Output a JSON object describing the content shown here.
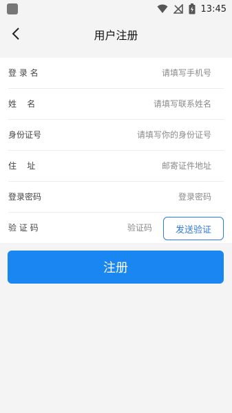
{
  "status": {
    "time": "13:45"
  },
  "header": {
    "title": "用户注册"
  },
  "form": {
    "fields": [
      {
        "label": "登 录 名",
        "placeholder": "请填写手机号"
      },
      {
        "label": "姓    名",
        "placeholder": "请填写联系姓名"
      },
      {
        "label": "身份证号",
        "placeholder": "请填写你的身份证号"
      },
      {
        "label": "住    址",
        "placeholder": "邮寄证件地址"
      },
      {
        "label": "登录密码",
        "placeholder": "登录密码"
      },
      {
        "label": "验 证 码",
        "placeholder": "验证码"
      }
    ],
    "send_code_label": "发送验证"
  },
  "register_label": "注册",
  "icons": {
    "app": "app-notification-icon",
    "wifi": "wifi-icon",
    "signal": "no-signal-icon",
    "battery": "battery-charging-icon",
    "back": "back-arrow-icon"
  }
}
